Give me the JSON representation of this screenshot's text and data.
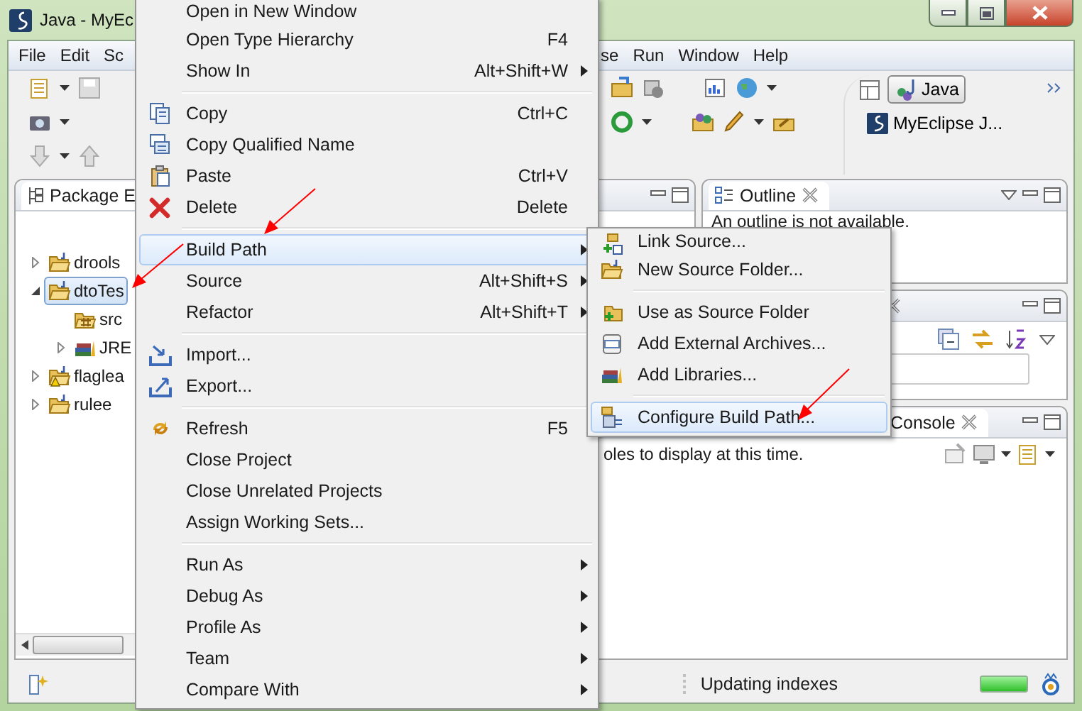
{
  "window": {
    "title": "Java - MyEc"
  },
  "menu_bar": {
    "left": [
      "File",
      "Edit",
      "Sc"
    ],
    "right": [
      "se",
      "Run",
      "Window",
      "Help"
    ]
  },
  "perspectives": [
    {
      "label": "Java",
      "selected": true
    },
    {
      "label": "MyEclipse J...",
      "selected": false
    }
  ],
  "package_explorer": {
    "tab": "Package E",
    "tree": [
      {
        "label": "drools",
        "kind": "project",
        "expanded": false,
        "selected": false,
        "warning": false
      },
      {
        "label": "dtoTes",
        "kind": "project",
        "expanded": true,
        "selected": true,
        "warning": false,
        "children": [
          {
            "label": "src",
            "kind": "source_folder",
            "selected": false
          },
          {
            "label": "JRE",
            "kind": "library",
            "expanded": false,
            "selected": false
          }
        ]
      },
      {
        "label": "flaglea",
        "kind": "project",
        "expanded": false,
        "selected": false,
        "warning": true
      },
      {
        "label": "rulee",
        "kind": "project",
        "expanded": false,
        "selected": false,
        "warning": false
      }
    ]
  },
  "outline": {
    "tab": "Outline",
    "message": "An outline is not available."
  },
  "console": {
    "tab": "Console",
    "message": "oles to display at this time."
  },
  "context_menu": {
    "items": [
      {
        "kind": "item",
        "label": "Open in New Window",
        "submenu": false,
        "selected": false
      },
      {
        "kind": "item",
        "label": "Open Type Hierarchy",
        "shortcut": "F4",
        "submenu": false,
        "selected": false
      },
      {
        "kind": "item",
        "label": "Show In",
        "shortcut": "Alt+Shift+W",
        "submenu": true,
        "selected": false
      },
      {
        "kind": "separator"
      },
      {
        "kind": "item",
        "label": "Copy",
        "shortcut": "Ctrl+C",
        "submenu": false,
        "selected": false
      },
      {
        "kind": "item",
        "label": "Copy Qualified Name",
        "submenu": false,
        "selected": false
      },
      {
        "kind": "item",
        "label": "Paste",
        "shortcut": "Ctrl+V",
        "submenu": false,
        "selected": false
      },
      {
        "kind": "item",
        "label": "Delete",
        "shortcut": "Delete",
        "submenu": false,
        "selected": false
      },
      {
        "kind": "separator"
      },
      {
        "kind": "item",
        "label": "Build Path",
        "submenu": true,
        "selected": true
      },
      {
        "kind": "item",
        "label": "Source",
        "shortcut": "Alt+Shift+S",
        "submenu": true,
        "selected": false
      },
      {
        "kind": "item",
        "label": "Refactor",
        "shortcut": "Alt+Shift+T",
        "submenu": true,
        "selected": false
      },
      {
        "kind": "separator"
      },
      {
        "kind": "item",
        "label": "Import...",
        "submenu": false,
        "selected": false
      },
      {
        "kind": "item",
        "label": "Export...",
        "submenu": false,
        "selected": false
      },
      {
        "kind": "separator"
      },
      {
        "kind": "item",
        "label": "Refresh",
        "shortcut": "F5",
        "submenu": false,
        "selected": false
      },
      {
        "kind": "item",
        "label": "Close Project",
        "submenu": false,
        "selected": false
      },
      {
        "kind": "item",
        "label": "Close Unrelated Projects",
        "submenu": false,
        "selected": false
      },
      {
        "kind": "item",
        "label": "Assign Working Sets...",
        "submenu": false,
        "selected": false
      },
      {
        "kind": "separator"
      },
      {
        "kind": "item",
        "label": "Run As",
        "submenu": true,
        "selected": false
      },
      {
        "kind": "item",
        "label": "Debug As",
        "submenu": true,
        "selected": false
      },
      {
        "kind": "item",
        "label": "Profile As",
        "submenu": true,
        "selected": false
      },
      {
        "kind": "item",
        "label": "Team",
        "submenu": true,
        "selected": false
      },
      {
        "kind": "item",
        "label": "Compare With",
        "submenu": true,
        "selected": false
      }
    ]
  },
  "submenu": {
    "items": [
      {
        "kind": "item",
        "label": "Link Source...",
        "selected": false
      },
      {
        "kind": "item",
        "label": "New Source Folder...",
        "selected": false
      },
      {
        "kind": "separator"
      },
      {
        "kind": "item",
        "label": "Use as Source Folder",
        "selected": false
      },
      {
        "kind": "item",
        "label": "Add External Archives...",
        "selected": false
      },
      {
        "kind": "item",
        "label": "Add Libraries...",
        "selected": false
      },
      {
        "kind": "separator"
      },
      {
        "kind": "item",
        "label": "Configure Build Path...",
        "selected": true
      }
    ]
  },
  "status_bar": {
    "message": "Updating indexes",
    "progress": {
      "level": 1
    }
  }
}
